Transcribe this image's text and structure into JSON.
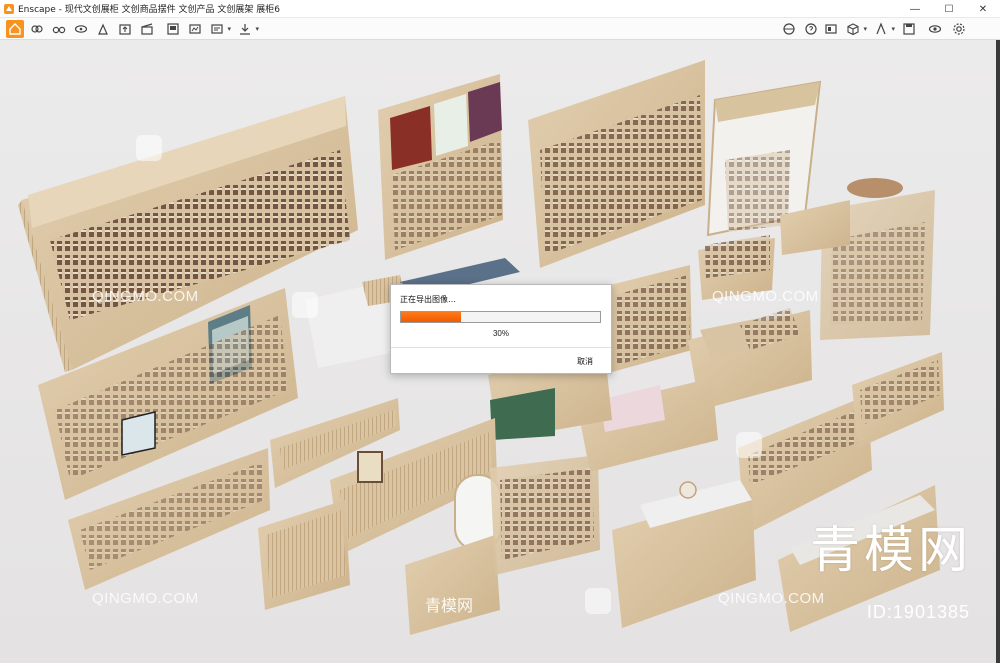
{
  "window": {
    "title": "Enscape - 现代文创展柜 文创商品摆件 文创产品 文创展架 展柜6",
    "controls": [
      "minimize-icon",
      "maximize-icon",
      "close-icon"
    ]
  },
  "toolbar": {
    "active_color": "#f7931e",
    "icons": [
      "home-icon",
      "link-icon",
      "binoculars-icon",
      "eye-icon",
      "person-icon",
      "upload-icon",
      "clapperboard-icon",
      "render-icon",
      "screenshot-icon",
      "view-list-icon",
      "export-icon",
      "panorama-icon",
      "help-icon",
      "batch-icon",
      "cube-icon",
      "asset-icon",
      "figure-icon",
      "save-icon",
      "visual-settings-icon",
      "settings-icon"
    ]
  },
  "dialog": {
    "title": "正在导出图像…",
    "progress": 0.3,
    "progress_label": "30%",
    "cancel_label": "取消"
  },
  "watermarks": {
    "brand_en": "QINGMO.COM",
    "brand_cn": "青模网",
    "id_text": "ID:1901385"
  }
}
